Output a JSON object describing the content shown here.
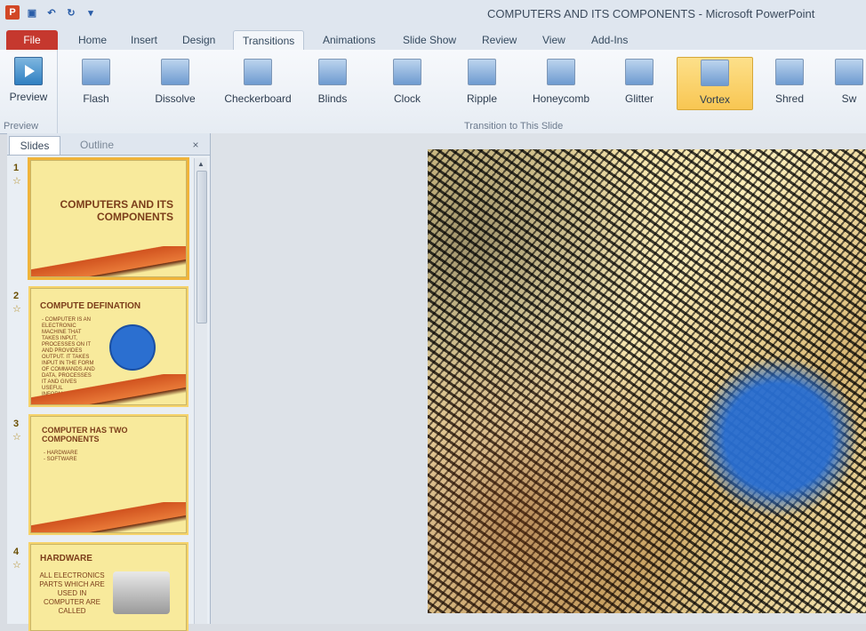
{
  "window": {
    "title": "COMPUTERS AND ITS COMPONENTS  -  Microsoft PowerPoint"
  },
  "tabs": [
    "File",
    "Home",
    "Insert",
    "Design",
    "Transitions",
    "Animations",
    "Slide Show",
    "Review",
    "View",
    "Add-Ins"
  ],
  "ribbon": {
    "preview_label": "Preview",
    "preview_group": "Preview",
    "transition_group": "Transition to This Slide",
    "transitions": [
      "Flash",
      "Dissolve",
      "Checkerboard",
      "Blinds",
      "Clock",
      "Ripple",
      "Honeycomb",
      "Glitter",
      "Vortex",
      "Shred",
      "Sw"
    ],
    "selected": "Vortex"
  },
  "pane": {
    "tab_slides": "Slides",
    "tab_outline": "Outline",
    "close": "×"
  },
  "slides": [
    {
      "num": "1",
      "title": "COMPUTERS AND ITS COMPONENTS",
      "body": ""
    },
    {
      "num": "2",
      "title": "COMPUTE  DEFINATION",
      "body": "- COMPUTER IS AN ELECTRONIC MACHINE THAT TAKES INPUT, PROCESSES ON IT AND PROVIDES OUTPUT. IT TAKES INPUT IN THE FORM OF COMMANDS AND DATA, PROCESSES IT AND GIVES USEFUL INFORMATION AS OUTPUT"
    },
    {
      "num": "3",
      "title": "COMPUTER HAS TWO COMPONENTS",
      "body": "- HARDWARE\n- SOFTWARE"
    },
    {
      "num": "4",
      "title": "HARDWARE",
      "body": "ALL ELECTRONICS PARTS WHICH ARE USED IN COMPUTER ARE CALLED"
    }
  ]
}
